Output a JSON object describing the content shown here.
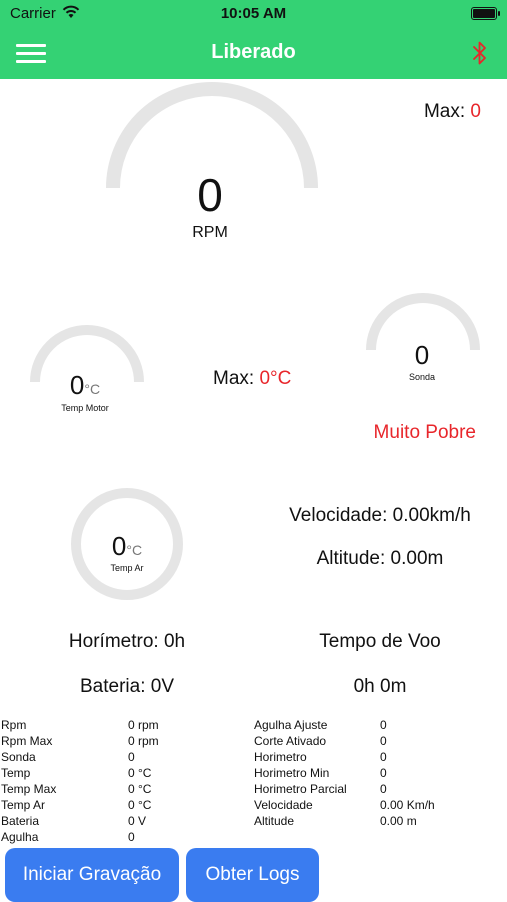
{
  "status_bar": {
    "carrier": "Carrier",
    "time": "10:05 AM"
  },
  "nav": {
    "title": "Liberado",
    "menu_icon": "hamburger-menu-icon",
    "right_icon": "bluetooth-icon"
  },
  "colors": {
    "green": "#34d274",
    "red": "#e8262b",
    "blue": "#3a7cf0",
    "gauge_track": "#e5e5e5"
  },
  "rpm": {
    "value": "0",
    "label": "RPM",
    "max_label": "Max: ",
    "max_value": "0"
  },
  "temp_motor": {
    "value": "0",
    "unit": "°C",
    "label": "Temp Motor"
  },
  "temp_max": {
    "label": "Max: ",
    "value": "0°C"
  },
  "sonda": {
    "value": "0",
    "label": "Sonda",
    "status": "Muito Pobre"
  },
  "temp_ar": {
    "value": "0",
    "unit": "°C",
    "label": "Temp Ar"
  },
  "velocidade": "Velocidade: 0.00km/h",
  "altitude": "Altitude: 0.00m",
  "horimetro": "Horímetro: 0h",
  "tempo_voo_label": "Tempo de Voo",
  "bateria": "Bateria: 0V",
  "tempo_voo_value": "0h 0m",
  "table_left": [
    {
      "k": "Rpm",
      "v": "0 rpm"
    },
    {
      "k": "Rpm Max",
      "v": "0 rpm"
    },
    {
      "k": "Sonda",
      "v": "0"
    },
    {
      "k": "Temp",
      "v": "0 °C"
    },
    {
      "k": "Temp Max",
      "v": "0 °C"
    },
    {
      "k": "Temp Ar",
      "v": "0 °C"
    },
    {
      "k": "Bateria",
      "v": "0 V"
    },
    {
      "k": "Agulha",
      "v": "0"
    }
  ],
  "table_right": [
    {
      "k": "Agulha Ajuste",
      "v": "0"
    },
    {
      "k": "Corte Ativado",
      "v": "0"
    },
    {
      "k": "Horimetro",
      "v": "0"
    },
    {
      "k": "Horimetro Min",
      "v": "0"
    },
    {
      "k": "Horimetro Parcial",
      "v": "0"
    },
    {
      "k": "Velocidade",
      "v": "0.00 Km/h"
    },
    {
      "k": "Altitude",
      "v": "0.00 m"
    }
  ],
  "buttons": {
    "start_recording": "Iniciar Gravação",
    "get_logs": "Obter Logs"
  }
}
